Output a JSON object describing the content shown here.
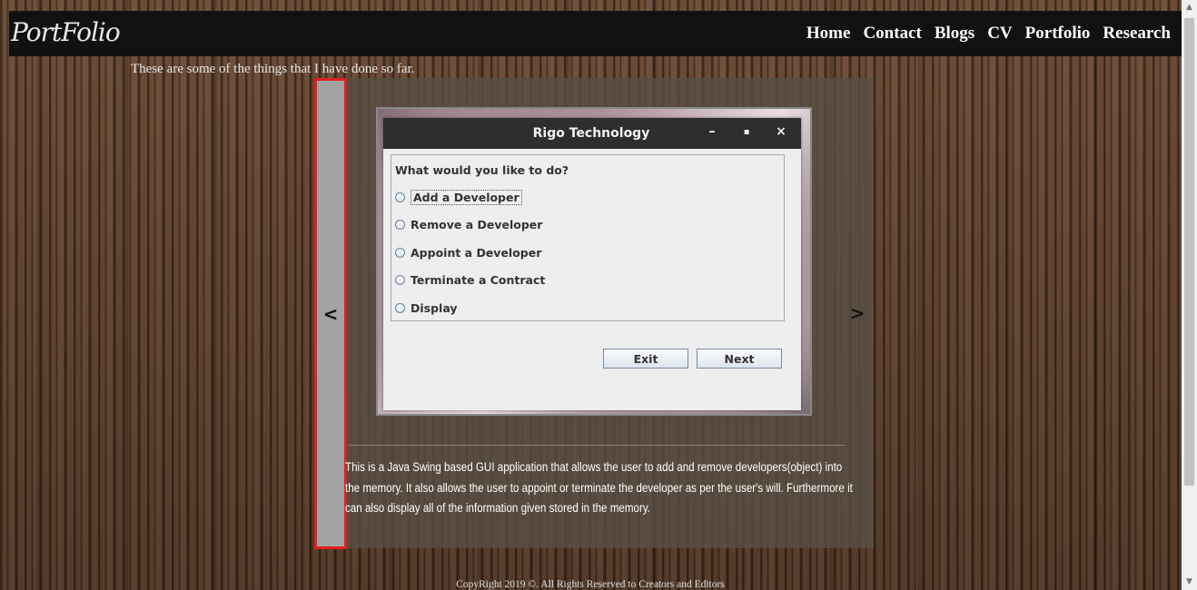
{
  "brand": {
    "logo": "PortFolio"
  },
  "nav": {
    "items": [
      {
        "label": "Home"
      },
      {
        "label": "Contact"
      },
      {
        "label": "Blogs"
      },
      {
        "label": "CV"
      },
      {
        "label": "Portfolio"
      },
      {
        "label": "Research"
      }
    ]
  },
  "intro": "These are some of the things that I have done so far.",
  "slider": {
    "prev_label": "<",
    "next_label": ">",
    "description": "This is a Java Swing based GUI application that allows the user to add and remove developers(object) into the memory. It also allows the user to appoint or terminate the developer as per the user's will. Furthermore it can also display all of the information given stored in the memory."
  },
  "java_window": {
    "title": "Rigo Technology",
    "controls": {
      "minimize": "–",
      "maximize": "▪",
      "close": "×"
    },
    "question": "What would you like to do?",
    "options": [
      {
        "label": "Add a Developer"
      },
      {
        "label": "Remove a Developer"
      },
      {
        "label": "Appoint a Developer"
      },
      {
        "label": "Terminate a Contract"
      },
      {
        "label": "Display"
      }
    ],
    "buttons": {
      "exit": "Exit",
      "next": "Next"
    }
  },
  "footer": "CopyRight 2019 ©. All Rights Reserved to Creators and Editors",
  "scrollbar": {
    "up": "▲",
    "down": "▼"
  }
}
